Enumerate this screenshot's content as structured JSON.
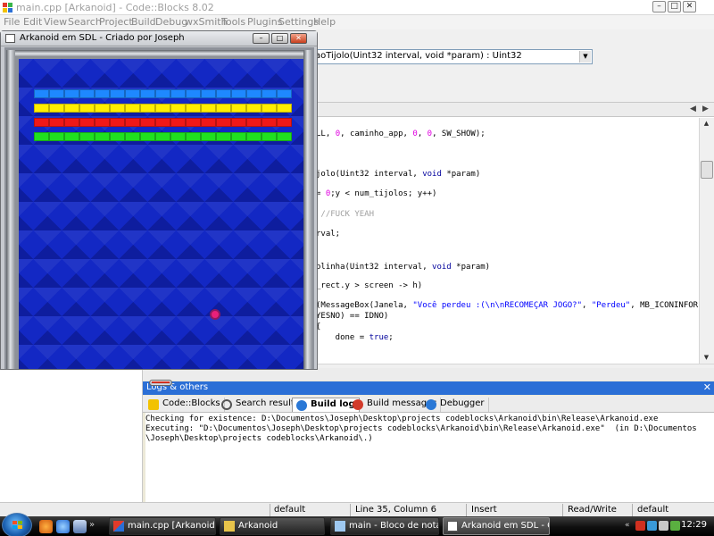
{
  "codeblocks": {
    "title": "main.cpp [Arkanoid] - Code::Blocks 8.02",
    "menu": [
      "File",
      "Edit",
      "View",
      "Search",
      "Project",
      "Build",
      "Debug",
      "wxSmith",
      "Tools",
      "Plugins",
      "Settings",
      "Help"
    ],
    "function_combo": "aoTijolo(Uint32 interval, void *param) : Uint32"
  },
  "editor": {
    "code_lines": [
      {
        "parts": [
          {
            "t": "LL, ",
            "c": ""
          },
          {
            "t": "0",
            "c": "num"
          },
          {
            "t": ", caminho_app, ",
            "c": ""
          },
          {
            "t": "0",
            "c": "num"
          },
          {
            "t": ", ",
            "c": ""
          },
          {
            "t": "0",
            "c": "num"
          },
          {
            "t": ", SW_SHOW);",
            "c": ""
          }
        ]
      },
      {
        "parts": [
          {
            "t": "jolo(Uint32 interval, ",
            "c": ""
          },
          {
            "t": "void",
            "c": "kw"
          },
          {
            "t": " *param)",
            "c": ""
          }
        ]
      },
      {
        "parts": [
          {
            "t": "= ",
            "c": ""
          },
          {
            "t": "0",
            "c": "num"
          },
          {
            "t": ";y < num_tijolos; y++)",
            "c": ""
          }
        ]
      },
      {
        "parts": [
          {
            "t": " //FUCK YEAH",
            "c": "cmt"
          }
        ]
      },
      {
        "parts": [
          {
            "t": "rval;",
            "c": ""
          }
        ]
      },
      {
        "parts": [
          {
            "t": "olinha(Uint32 interval, ",
            "c": ""
          },
          {
            "t": "void",
            "c": "kw"
          },
          {
            "t": " *param)",
            "c": ""
          }
        ]
      },
      {
        "parts": [
          {
            "t": "_rect.y > screen -> h)",
            "c": ""
          }
        ]
      },
      {
        "parts": [
          {
            "t": "(MessageBox(Janela, ",
            "c": ""
          },
          {
            "t": "\"Você perdeu :(\\n\\nRECOMEÇAR JOGO?\"",
            "c": "str"
          },
          {
            "t": ", ",
            "c": ""
          },
          {
            "t": "\"Perdeu\"",
            "c": "str"
          },
          {
            "t": ", MB_ICONINFOR",
            "c": ""
          }
        ]
      },
      {
        "parts": [
          {
            "t": "YESNO) == IDNO)",
            "c": ""
          }
        ]
      },
      {
        "parts": [
          {
            "t": "{",
            "c": ""
          }
        ]
      },
      {
        "parts": [
          {
            "t": "    done = ",
            "c": ""
          },
          {
            "t": "true",
            "c": "kw"
          },
          {
            "t": ";",
            "c": ""
          }
        ]
      }
    ]
  },
  "logs": {
    "header": "Logs & others",
    "tabs": [
      "Code::Blocks",
      "Search results",
      "Build log",
      "Build messages",
      "Debugger"
    ],
    "active_tab": "Build log",
    "lines": [
      "Checking for existence: D:\\Documentos\\Joseph\\Desktop\\projects codeblocks\\Arkanoid\\bin\\Release\\Arkanoid.exe",
      "Executing: \"D:\\Documentos\\Joseph\\Desktop\\projects codeblocks\\Arkanoid\\bin\\Release\\Arkanoid.exe\"  (in D:\\Documentos",
      "\\Joseph\\Desktop\\projects codeblocks\\Arkanoid\\.)"
    ]
  },
  "statusbar": {
    "encoding": "default",
    "position": "Line 35, Column 6",
    "mode": "Insert",
    "access": "Read/Write",
    "lang": "default"
  },
  "sdl": {
    "title": "Arkanoid em SDL - Criado por Joseph",
    "brick_rows": [
      {
        "color": "#1e88ff",
        "count": 17
      },
      {
        "color": "#ffee00",
        "count": 17
      },
      {
        "color": "#f01818",
        "count": 17
      },
      {
        "color": "#20e020",
        "count": 17
      }
    ],
    "brick_step": 17
  },
  "taskbar": {
    "buttons": [
      "main.cpp [Arkanoid] - ...",
      "Arkanoid",
      "main - Bloco de notas",
      "Arkanoid em SDL - Cri..."
    ],
    "clock": "12:29"
  }
}
